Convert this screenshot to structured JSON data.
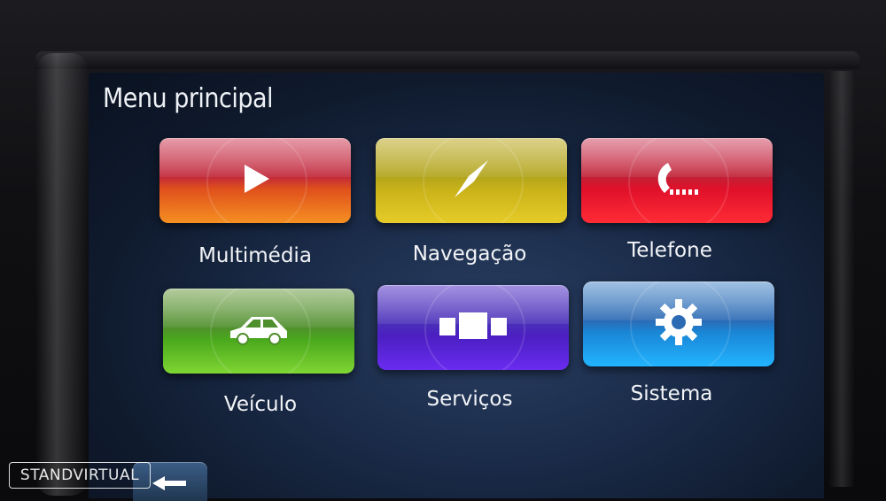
{
  "screen": {
    "title": "Menu principal"
  },
  "menu": {
    "items": [
      {
        "label": "Multimédia",
        "icon": "play-icon",
        "color": "#e0501c"
      },
      {
        "label": "Navegação",
        "icon": "compass-icon",
        "color": "#c9b219"
      },
      {
        "label": "Telefone",
        "icon": "phone-icon",
        "color": "#e0102a"
      },
      {
        "label": "Veículo",
        "icon": "car-icon",
        "color": "#4aa81c"
      },
      {
        "label": "Serviços",
        "icon": "services-blocks-icon",
        "color": "#4b1fc2"
      },
      {
        "label": "Sistema",
        "icon": "gear-icon",
        "color": "#1a86d6"
      }
    ]
  },
  "back_button": {
    "icon": "back-arrow-icon"
  },
  "watermark": {
    "text": "STANDVIRTUAL"
  }
}
